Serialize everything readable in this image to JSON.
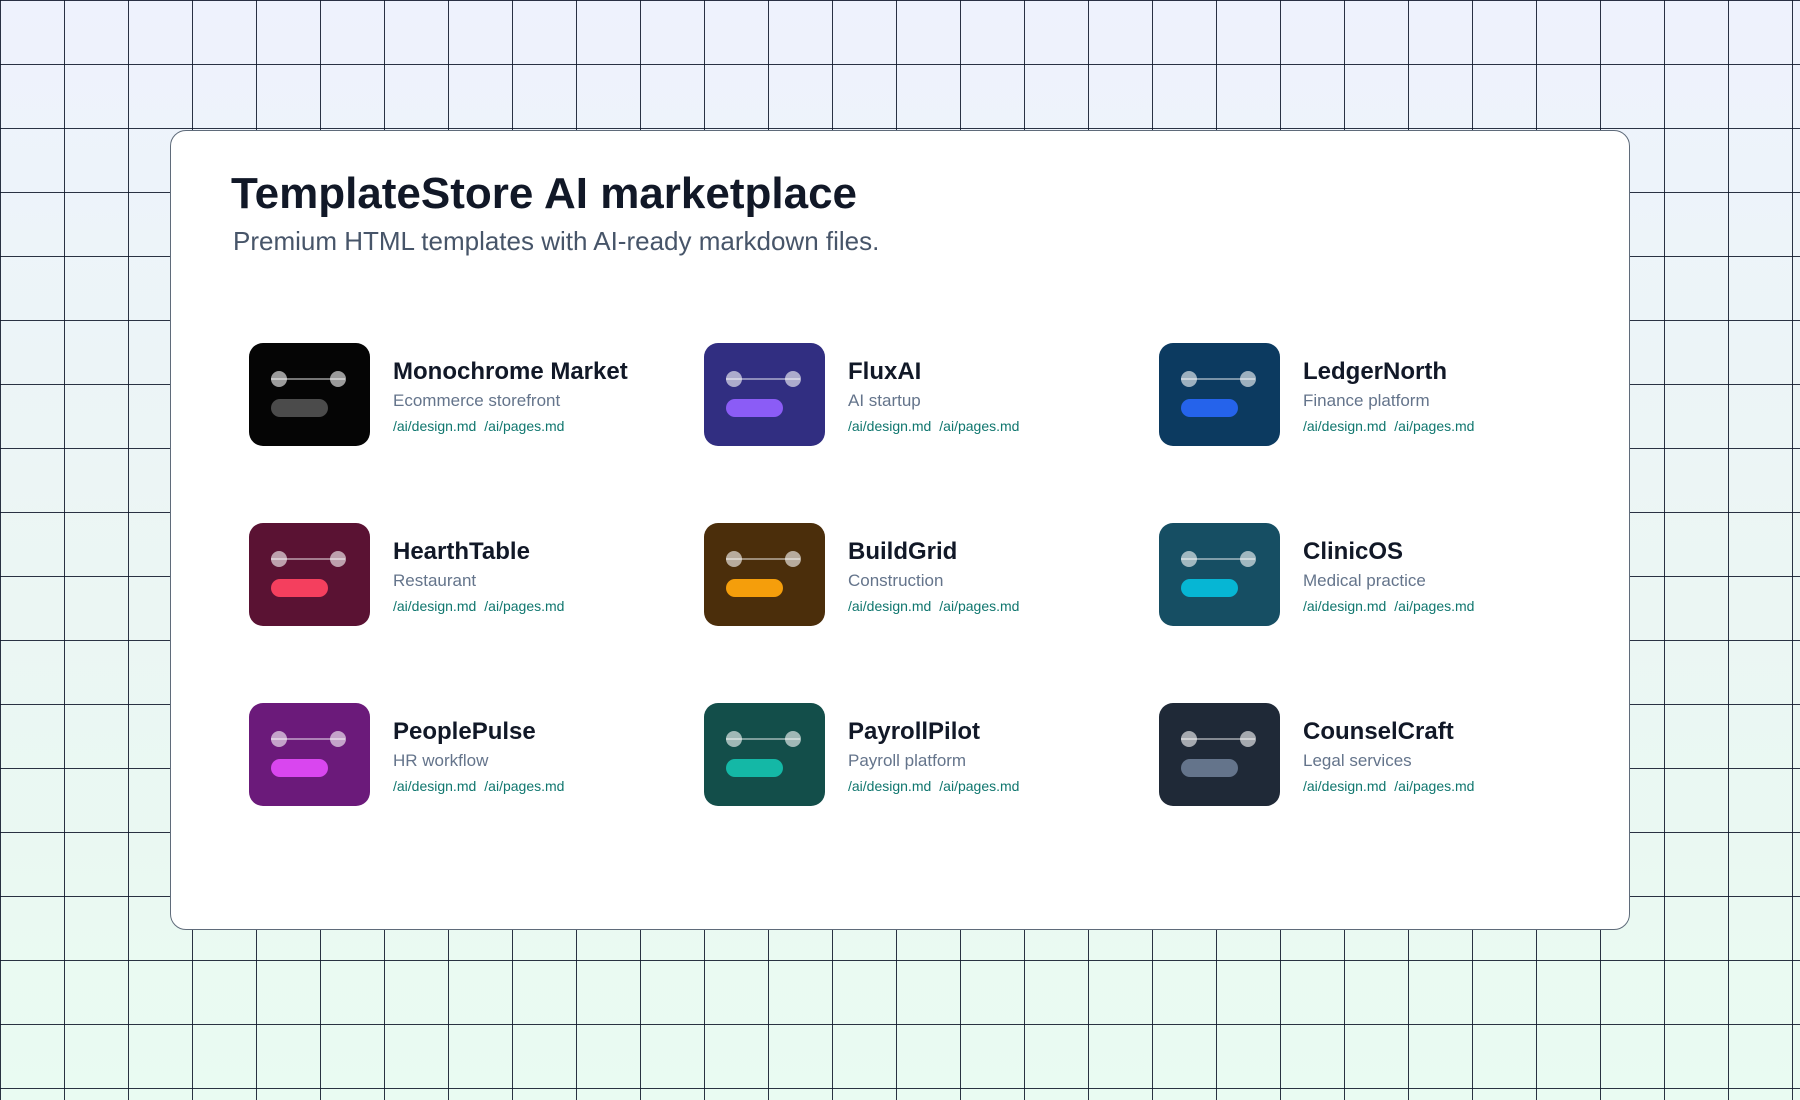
{
  "header": {
    "title": "TemplateStore AI marketplace",
    "subtitle": "Premium HTML templates with AI-ready markdown files."
  },
  "templates": [
    {
      "name": "Monochrome Market",
      "category": "Ecommerce storefront",
      "files": [
        "/ai/design.md",
        "/ai/pages.md"
      ],
      "thumb_bg": "#050505",
      "accent": "#4b4b4b"
    },
    {
      "name": "FluxAI",
      "category": "AI startup",
      "files": [
        "/ai/design.md",
        "/ai/pages.md"
      ],
      "thumb_bg": "#312e81",
      "accent": "#8b5cf6"
    },
    {
      "name": "LedgerNorth",
      "category": "Finance platform",
      "files": [
        "/ai/design.md",
        "/ai/pages.md"
      ],
      "thumb_bg": "#0c3a60",
      "accent": "#2563eb"
    },
    {
      "name": "HearthTable",
      "category": "Restaurant",
      "files": [
        "/ai/design.md",
        "/ai/pages.md"
      ],
      "thumb_bg": "#5a1233",
      "accent": "#f43f5e"
    },
    {
      "name": "BuildGrid",
      "category": "Construction",
      "files": [
        "/ai/design.md",
        "/ai/pages.md"
      ],
      "thumb_bg": "#4b2e0b",
      "accent": "#f59e0b"
    },
    {
      "name": "ClinicOS",
      "category": "Medical practice",
      "files": [
        "/ai/design.md",
        "/ai/pages.md"
      ],
      "thumb_bg": "#164e63",
      "accent": "#06b6d4"
    },
    {
      "name": "PeoplePulse",
      "category": "HR workflow",
      "files": [
        "/ai/design.md",
        "/ai/pages.md"
      ],
      "thumb_bg": "#6b1a7a",
      "accent": "#d946ef"
    },
    {
      "name": "PayrollPilot",
      "category": "Payroll platform",
      "files": [
        "/ai/design.md",
        "/ai/pages.md"
      ],
      "thumb_bg": "#134e4a",
      "accent": "#14b8a6"
    },
    {
      "name": "CounselCraft",
      "category": "Legal services",
      "files": [
        "/ai/design.md",
        "/ai/pages.md"
      ],
      "thumb_bg": "#1f2937",
      "accent": "#64748b"
    }
  ]
}
